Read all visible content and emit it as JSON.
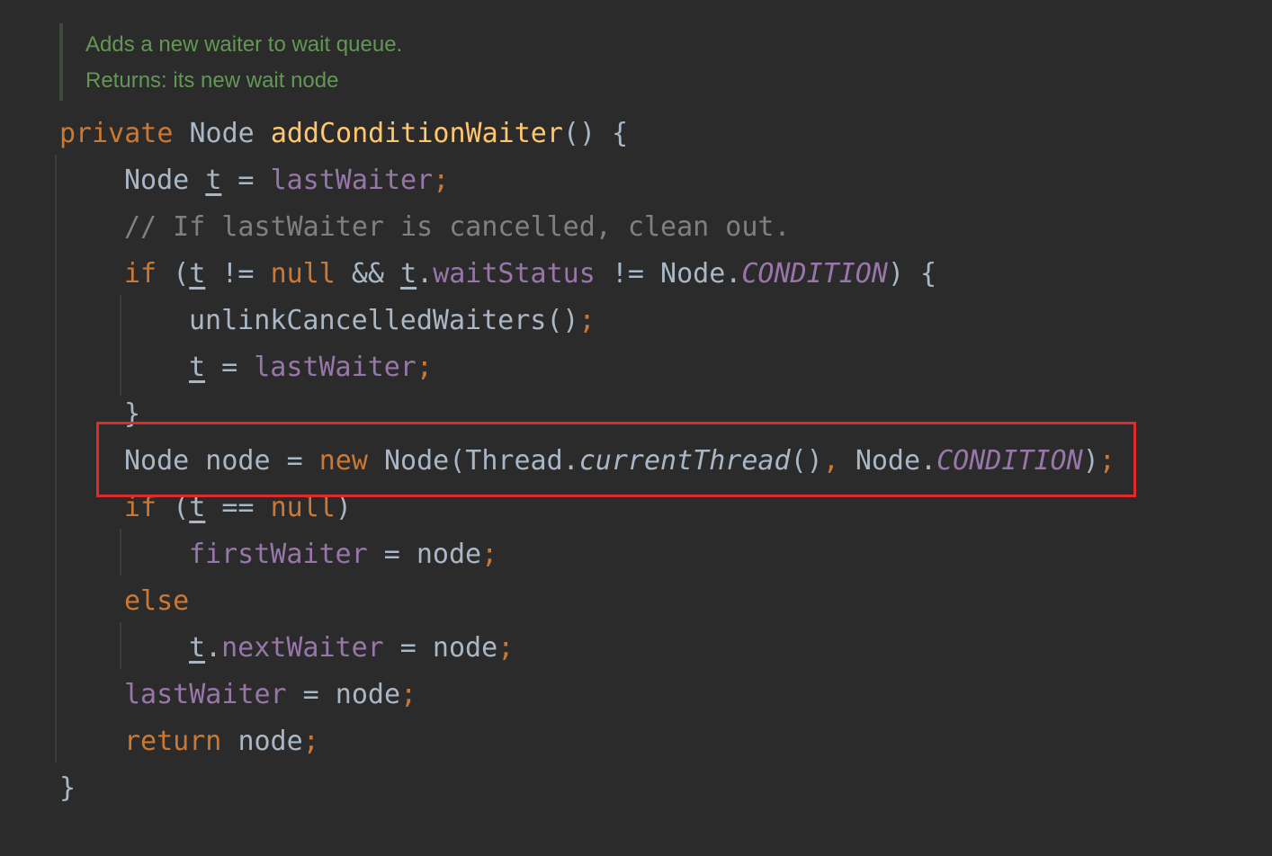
{
  "doc": {
    "line1": "Adds a new waiter to wait queue.",
    "line2": "Returns: its new wait node"
  },
  "lines": [
    [
      [
        "kw",
        "private "
      ],
      [
        "plain",
        "Node "
      ],
      [
        "fn",
        "addConditionWaiter"
      ],
      [
        "plain",
        "() {"
      ]
    ],
    [
      [
        "plain",
        "Node "
      ],
      [
        "plain ul",
        "t"
      ],
      [
        "plain",
        " = "
      ],
      [
        "fld",
        "lastWaiter"
      ],
      [
        "kw",
        ";"
      ]
    ],
    [
      [
        "cm",
        "// If lastWaiter is cancelled, clean out."
      ]
    ],
    [
      [
        "kw",
        "if "
      ],
      [
        "plain",
        "("
      ],
      [
        "plain ul",
        "t"
      ],
      [
        "plain",
        " != "
      ],
      [
        "kw",
        "null"
      ],
      [
        "plain",
        " && "
      ],
      [
        "plain ul",
        "t"
      ],
      [
        "plain",
        "."
      ],
      [
        "fld",
        "waitStatus"
      ],
      [
        "plain",
        " != Node."
      ],
      [
        "fld it",
        "CONDITION"
      ],
      [
        "plain",
        ") {"
      ]
    ],
    [
      [
        "plain",
        "unlinkCancelledWaiters()"
      ],
      [
        "kw",
        ";"
      ]
    ],
    [
      [
        "plain ul",
        "t"
      ],
      [
        "plain",
        " = "
      ],
      [
        "fld",
        "lastWaiter"
      ],
      [
        "kw",
        ";"
      ]
    ],
    [
      [
        "plain",
        "}"
      ]
    ],
    [
      [
        "plain",
        "Node node = "
      ],
      [
        "kw",
        "new "
      ],
      [
        "plain",
        "Node(Thread."
      ],
      [
        "plain it",
        "currentThread"
      ],
      [
        "plain",
        "()"
      ],
      [
        "kw",
        ", "
      ],
      [
        "plain",
        "Node."
      ],
      [
        "fld it",
        "CONDITION"
      ],
      [
        "plain",
        ")"
      ],
      [
        "kw",
        ";"
      ]
    ],
    [
      [
        "kw",
        "if "
      ],
      [
        "plain",
        "("
      ],
      [
        "plain ul",
        "t"
      ],
      [
        "plain",
        " == "
      ],
      [
        "kw",
        "null"
      ],
      [
        "plain",
        ")"
      ]
    ],
    [
      [
        "fld",
        "firstWaiter"
      ],
      [
        "plain",
        " = node"
      ],
      [
        "kw",
        ";"
      ]
    ],
    [
      [
        "kw",
        "else"
      ]
    ],
    [
      [
        "plain ul",
        "t"
      ],
      [
        "plain",
        "."
      ],
      [
        "fld",
        "nextWaiter"
      ],
      [
        "plain",
        " = node"
      ],
      [
        "kw",
        ";"
      ]
    ],
    [
      [
        "fld",
        "lastWaiter"
      ],
      [
        "plain",
        " = node"
      ],
      [
        "kw",
        ";"
      ]
    ],
    [
      [
        "kw",
        "return "
      ],
      [
        "plain",
        "node"
      ],
      [
        "kw",
        ";"
      ]
    ],
    [
      [
        "plain",
        "}"
      ]
    ]
  ]
}
